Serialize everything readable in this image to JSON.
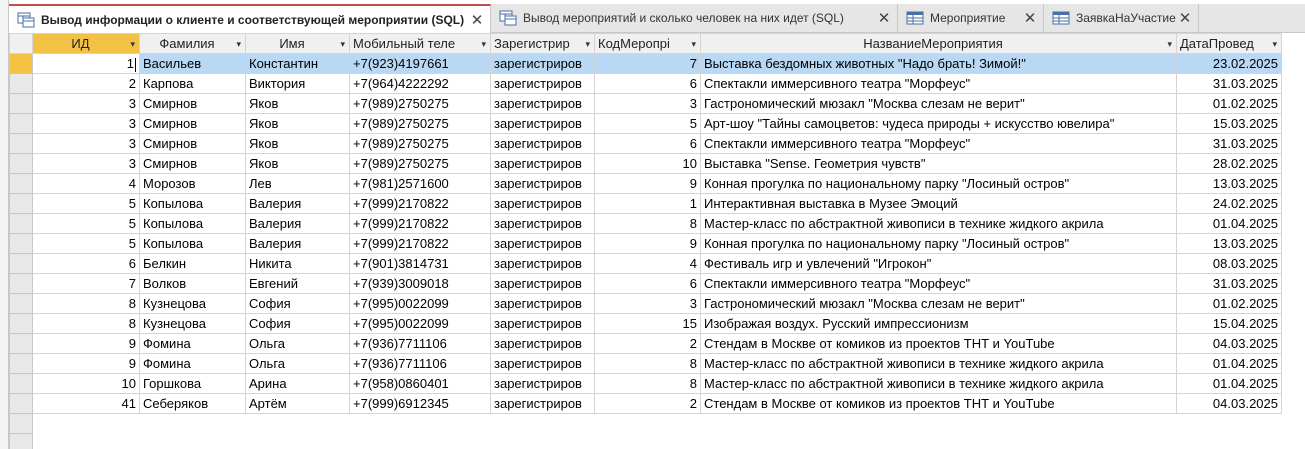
{
  "tabs": [
    {
      "label": "Вывод информации о клиенте и соответствующей мероприятии (SQL)",
      "icon": "query-icon",
      "active": true
    },
    {
      "label": "Вывод мероприятий и сколько человек на них идет (SQL)",
      "icon": "query-icon",
      "active": false
    },
    {
      "label": "Мероприятие",
      "icon": "table-icon",
      "active": false
    },
    {
      "label": "ЗаявкаНаУчастие",
      "icon": "table-icon",
      "active": false
    }
  ],
  "columns": [
    "ИД",
    "Фамилия",
    "Имя",
    "Мобильный теле",
    "Зарегистрир",
    "КодМеропрі",
    "НазваниеМероприятия",
    "ДатаПровед"
  ],
  "rows": [
    [
      "1",
      "Васильев",
      "Константин",
      "+7(923)4197661",
      "зарегистриров",
      "7",
      "Выставка бездомных животных \"Надо брать! Зимой!\"",
      "23.02.2025"
    ],
    [
      "2",
      "Карпова",
      "Виктория",
      "+7(964)4222292",
      "зарегистриров",
      "6",
      "Спектакли иммерсивного театра \"Морфеус\"",
      "31.03.2025"
    ],
    [
      "3",
      "Смирнов",
      "Яков",
      "+7(989)2750275",
      "зарегистриров",
      "3",
      "Гастрономический мюзакл \"Москва слезам не верит\"",
      "01.02.2025"
    ],
    [
      "3",
      "Смирнов",
      "Яков",
      "+7(989)2750275",
      "зарегистриров",
      "5",
      "Арт-шоу \"Тайны самоцветов: чудеса природы + искусство ювелира\"",
      "15.03.2025"
    ],
    [
      "3",
      "Смирнов",
      "Яков",
      "+7(989)2750275",
      "зарегистриров",
      "6",
      "Спектакли иммерсивного театра \"Морфеус\"",
      "31.03.2025"
    ],
    [
      "3",
      "Смирнов",
      "Яков",
      "+7(989)2750275",
      "зарегистриров",
      "10",
      "Выставка \"Sense. Геометрия чувств\"",
      "28.02.2025"
    ],
    [
      "4",
      "Морозов",
      "Лев",
      "+7(981)2571600",
      "зарегистриров",
      "9",
      "Конная прогулка по национальному парку \"Лосиный остров\"",
      "13.03.2025"
    ],
    [
      "5",
      "Копылова",
      "Валерия",
      "+7(999)2170822",
      "зарегистриров",
      "1",
      "Интерактивная выставка в Музее Эмоций",
      "24.02.2025"
    ],
    [
      "5",
      "Копылова",
      "Валерия",
      "+7(999)2170822",
      "зарегистриров",
      "8",
      "Мастер-класс по абстрактной живописи в технике жидкого акрила",
      "01.04.2025"
    ],
    [
      "5",
      "Копылова",
      "Валерия",
      "+7(999)2170822",
      "зарегистриров",
      "9",
      "Конная прогулка по национальному парку \"Лосиный остров\"",
      "13.03.2025"
    ],
    [
      "6",
      "Белкин",
      "Никита",
      "+7(901)3814731",
      "зарегистриров",
      "4",
      "Фестиваль игр и увлечений \"Игрокон\"",
      "08.03.2025"
    ],
    [
      "7",
      "Волков",
      "Евгений",
      "+7(939)3009018",
      "зарегистриров",
      "6",
      "Спектакли иммерсивного театра \"Морфеус\"",
      "31.03.2025"
    ],
    [
      "8",
      "Кузнецова",
      "София",
      "+7(995)0022099",
      "зарегистриров",
      "3",
      "Гастрономический мюзакл \"Москва слезам не верит\"",
      "01.02.2025"
    ],
    [
      "8",
      "Кузнецова",
      "София",
      "+7(995)0022099",
      "зарегистриров",
      "15",
      "Изображая воздух. Русский импрессионизм",
      "15.04.2025"
    ],
    [
      "9",
      "Фомина",
      "Ольга",
      "+7(936)7711106",
      "зарегистриров",
      "2",
      "Стендам в Москве от комиков из проектов ТНТ и YouTube",
      "04.03.2025"
    ],
    [
      "9",
      "Фомина",
      "Ольга",
      "+7(936)7711106",
      "зарегистриров",
      "8",
      "Мастер-класс по абстрактной живописи в технике жидкого акрила",
      "01.04.2025"
    ],
    [
      "10",
      "Горшкова",
      "Арина",
      "+7(958)0860401",
      "зарегистриров",
      "8",
      "Мастер-класс по абстрактной живописи в технике жидкого акрила",
      "01.04.2025"
    ],
    [
      "41",
      "Себеряков",
      "Артём",
      "+7(999)6912345",
      "зарегистриров",
      "2",
      "Стендам в Москве от комиков из проектов ТНТ и YouTube",
      "04.03.2025"
    ]
  ],
  "colors": {
    "active_tab_accent": "#c0504d",
    "selected_row": "#b8d8f4",
    "selected_header": "#f3c244"
  }
}
